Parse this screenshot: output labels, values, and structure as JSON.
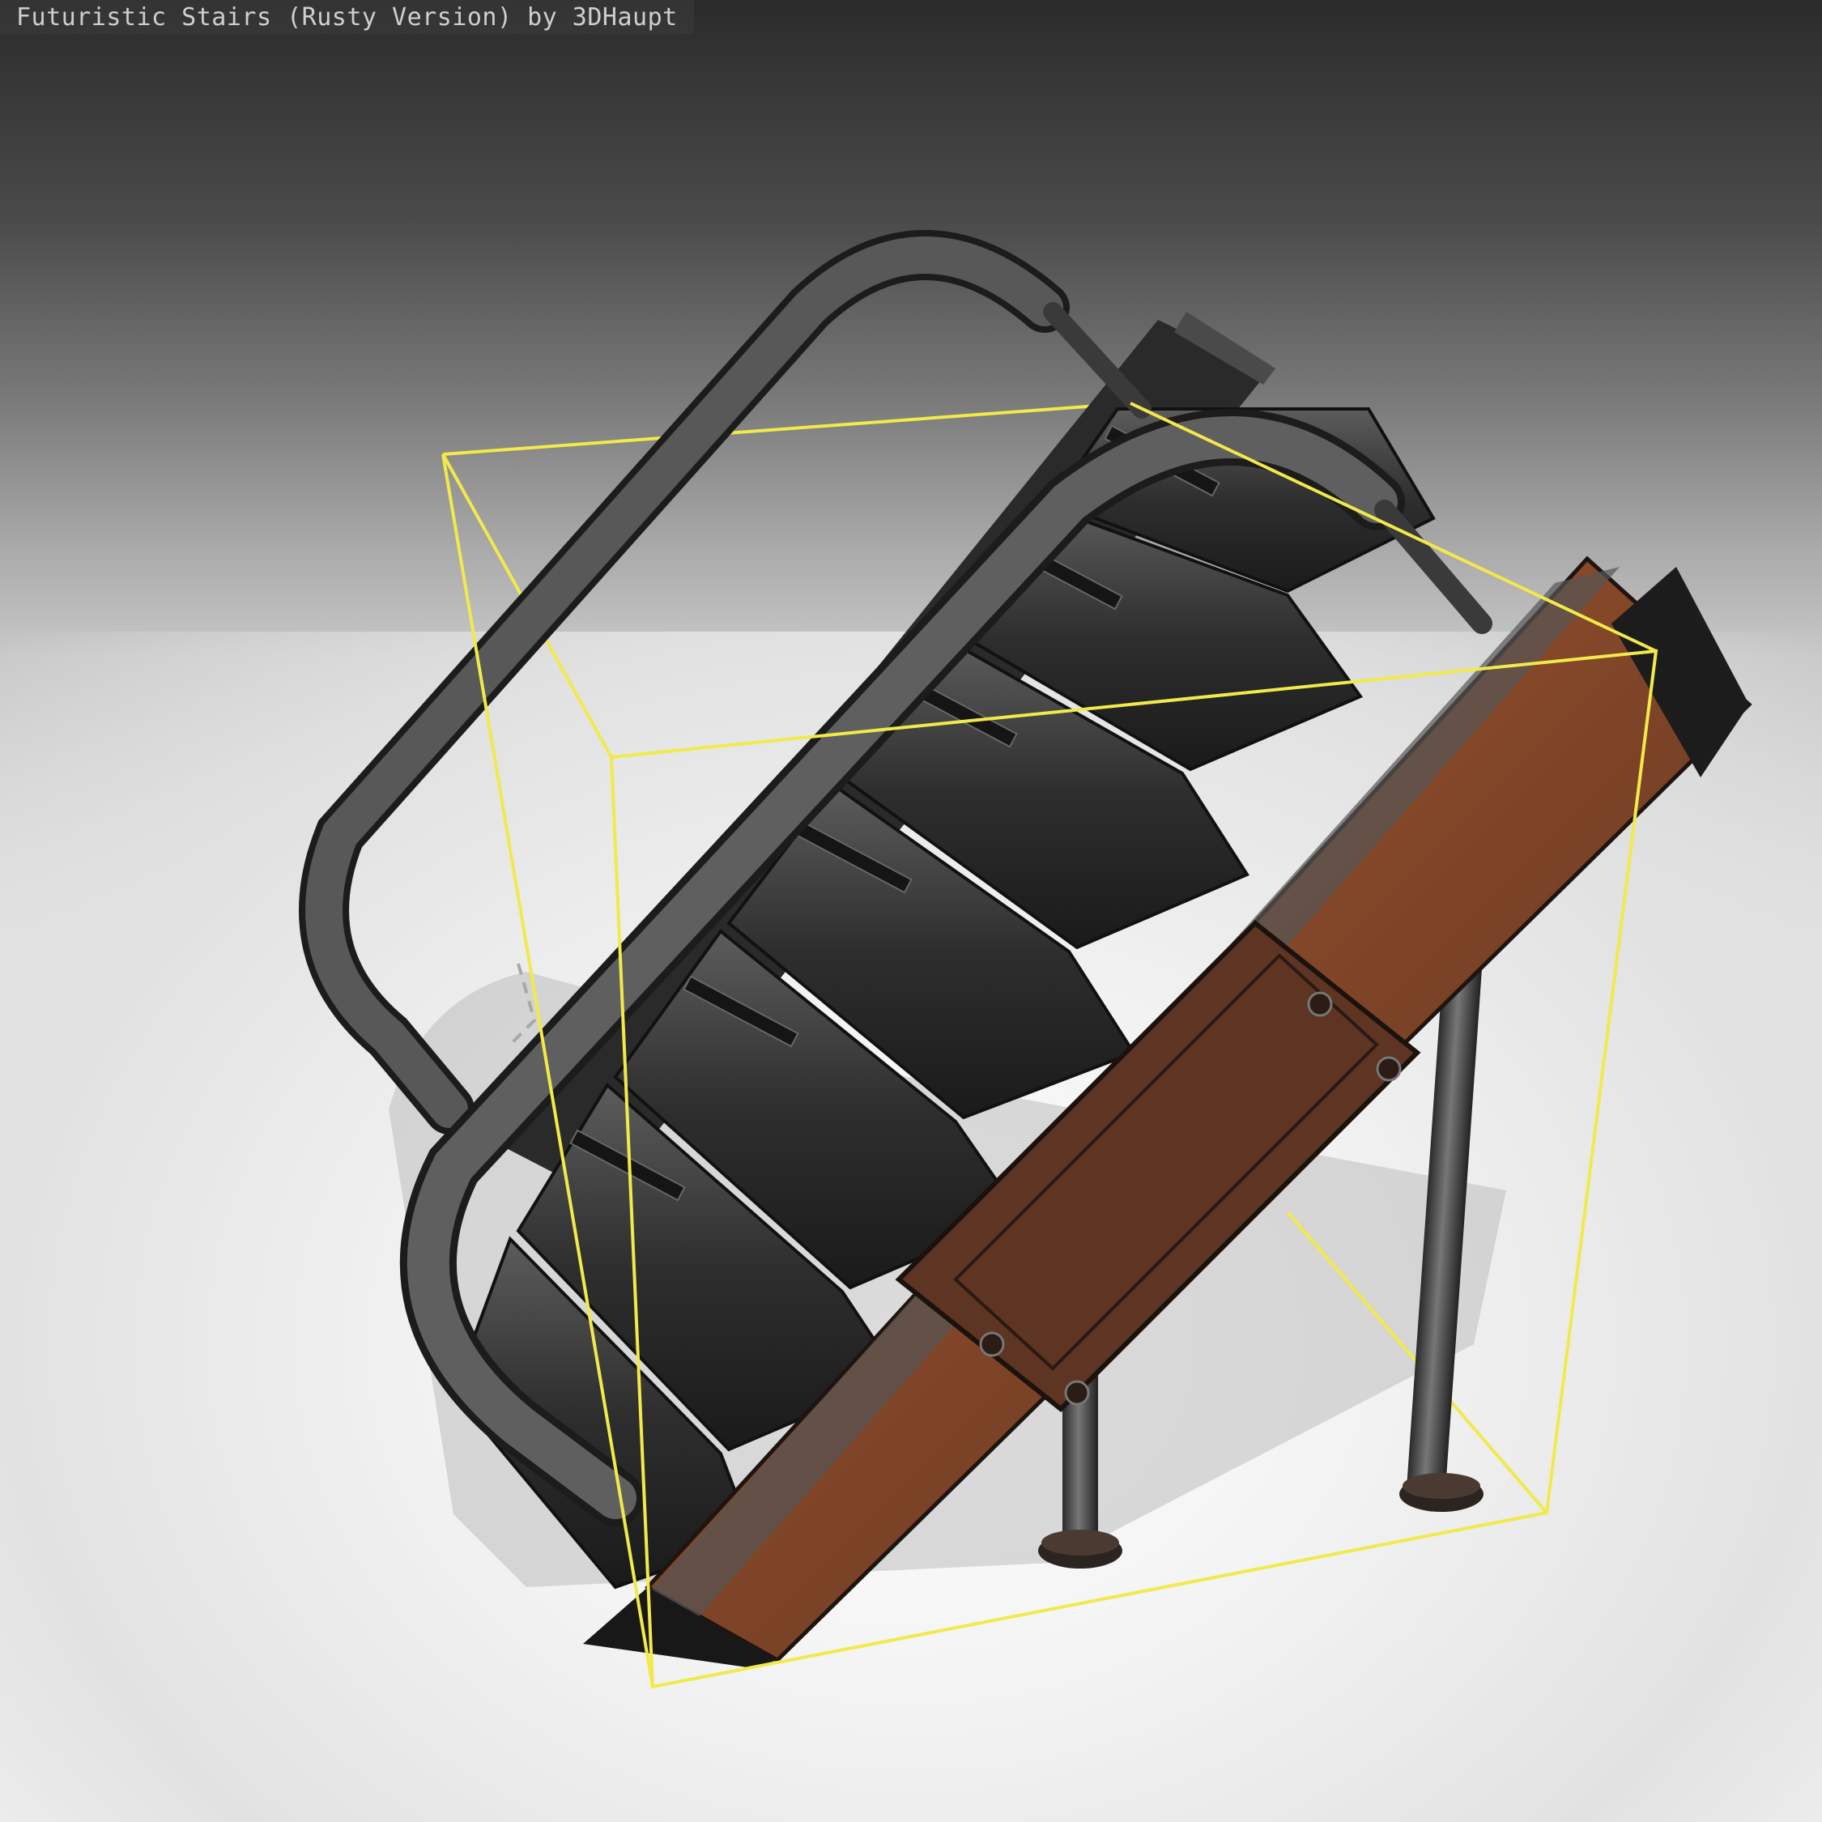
{
  "viewer": {
    "title": "Futuristic Stairs (Rusty Version) by 3DHaupt",
    "model_name": "Futuristic Stairs (Rusty Version)",
    "author": "3DHaupt",
    "bounding_box_color": "#f2e94a",
    "background_top_color": "#2b2b2b",
    "background_bottom_color": "#f6f6f6",
    "rust_color": "#8a4a2a",
    "metal_color": "#3a3a3a"
  }
}
